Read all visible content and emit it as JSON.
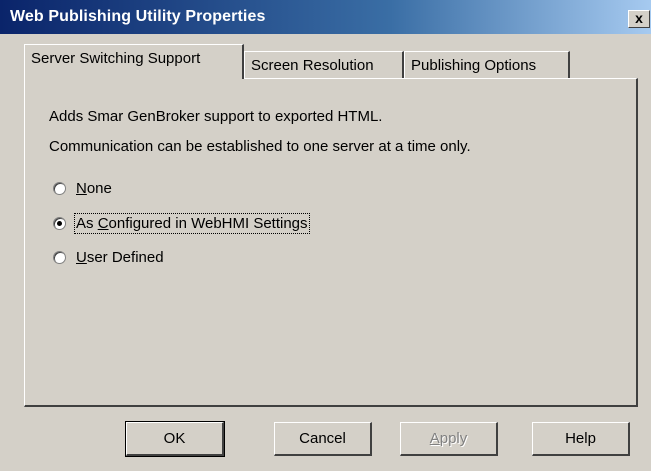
{
  "window": {
    "title": "Web Publishing Utility Properties",
    "close_glyph": "x"
  },
  "tabs": [
    {
      "label": "Server Switching Support",
      "active": true
    },
    {
      "label": "Screen Resolution",
      "active": false
    },
    {
      "label": "Publishing Options",
      "active": false
    }
  ],
  "panel": {
    "description_line1": "Adds Smar GenBroker support to exported HTML.",
    "description_line2": "Communication can be established to one server at a time only."
  },
  "radios": [
    {
      "label_first": "N",
      "label_rest": "one",
      "checked": false
    },
    {
      "label_pre": "As ",
      "label_first": "C",
      "label_rest": "onfigured in WebHMI Settings",
      "checked": true
    },
    {
      "label_first": "U",
      "label_rest": "ser Defined",
      "checked": false
    }
  ],
  "buttons": {
    "ok": "OK",
    "cancel": "Cancel",
    "apply_first": "A",
    "apply_rest": "pply",
    "help": "Help"
  },
  "colors": {
    "titlebar_start": "#0a246a",
    "titlebar_end": "#a6caf0",
    "face": "#d4d0c8"
  }
}
